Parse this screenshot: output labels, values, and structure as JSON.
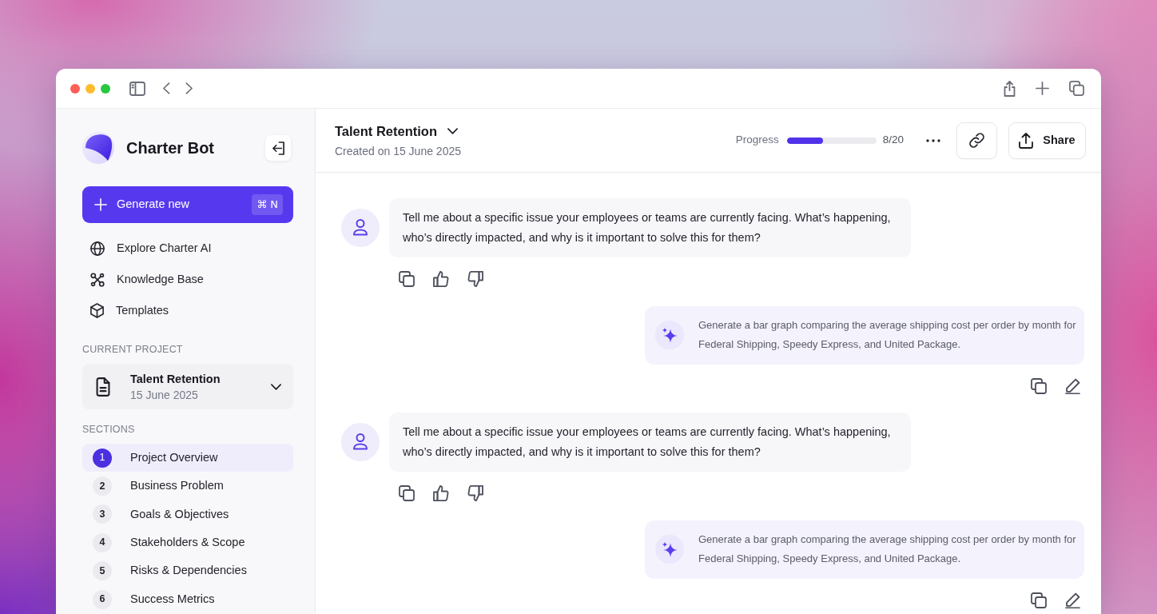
{
  "sidebar": {
    "app_name": "Charter Bot",
    "generate_button": {
      "label": "Generate new",
      "shortcut": "⌘ N"
    },
    "nav_items": [
      "Explore Charter AI",
      "Knowledge Base",
      "Templates"
    ]
  },
  "current_project": {
    "heading": "CURRENT PROJECT",
    "title": "Talent Retention",
    "date": "15 June 2025"
  },
  "sections": {
    "heading": "SECTIONS",
    "items": [
      {
        "number": "1",
        "label": "Project Overview",
        "selected": true
      },
      {
        "number": "2",
        "label": "Business Problem",
        "selected": false
      },
      {
        "number": "3",
        "label": "Goals & Objectives",
        "selected": false
      },
      {
        "number": "4",
        "label": "Stakeholders & Scope",
        "selected": false
      },
      {
        "number": "5",
        "label": "Risks & Dependencies",
        "selected": false
      },
      {
        "number": "6",
        "label": "Success Metrics",
        "selected": false
      }
    ]
  },
  "header": {
    "title": "Talent Retention",
    "subtitle": "Created on 15 June 2025",
    "progress": {
      "label": "Progress",
      "level": 0.4,
      "reading": "8/20"
    },
    "share_label": "Share"
  },
  "messages": [
    {
      "kind": "question",
      "text": "Tell me about a specific issue your employees or teams are currently facing. What’s happening, who’s directly impacted, and why is it important to solve this for them?"
    },
    {
      "kind": "prompt",
      "text": "Generate a bar graph comparing the average shipping cost per order by month for Federal Shipping, Speedy Express, and United Package."
    },
    {
      "kind": "question",
      "text": "Tell me about a specific issue your employees or teams are currently facing. What’s happening, who’s directly impacted, and why is it important to solve this for them?"
    },
    {
      "kind": "prompt",
      "text": "Generate a bar graph comparing the average shipping cost per order by month for Federal Shipping, Speedy Express, and United Package."
    }
  ]
}
